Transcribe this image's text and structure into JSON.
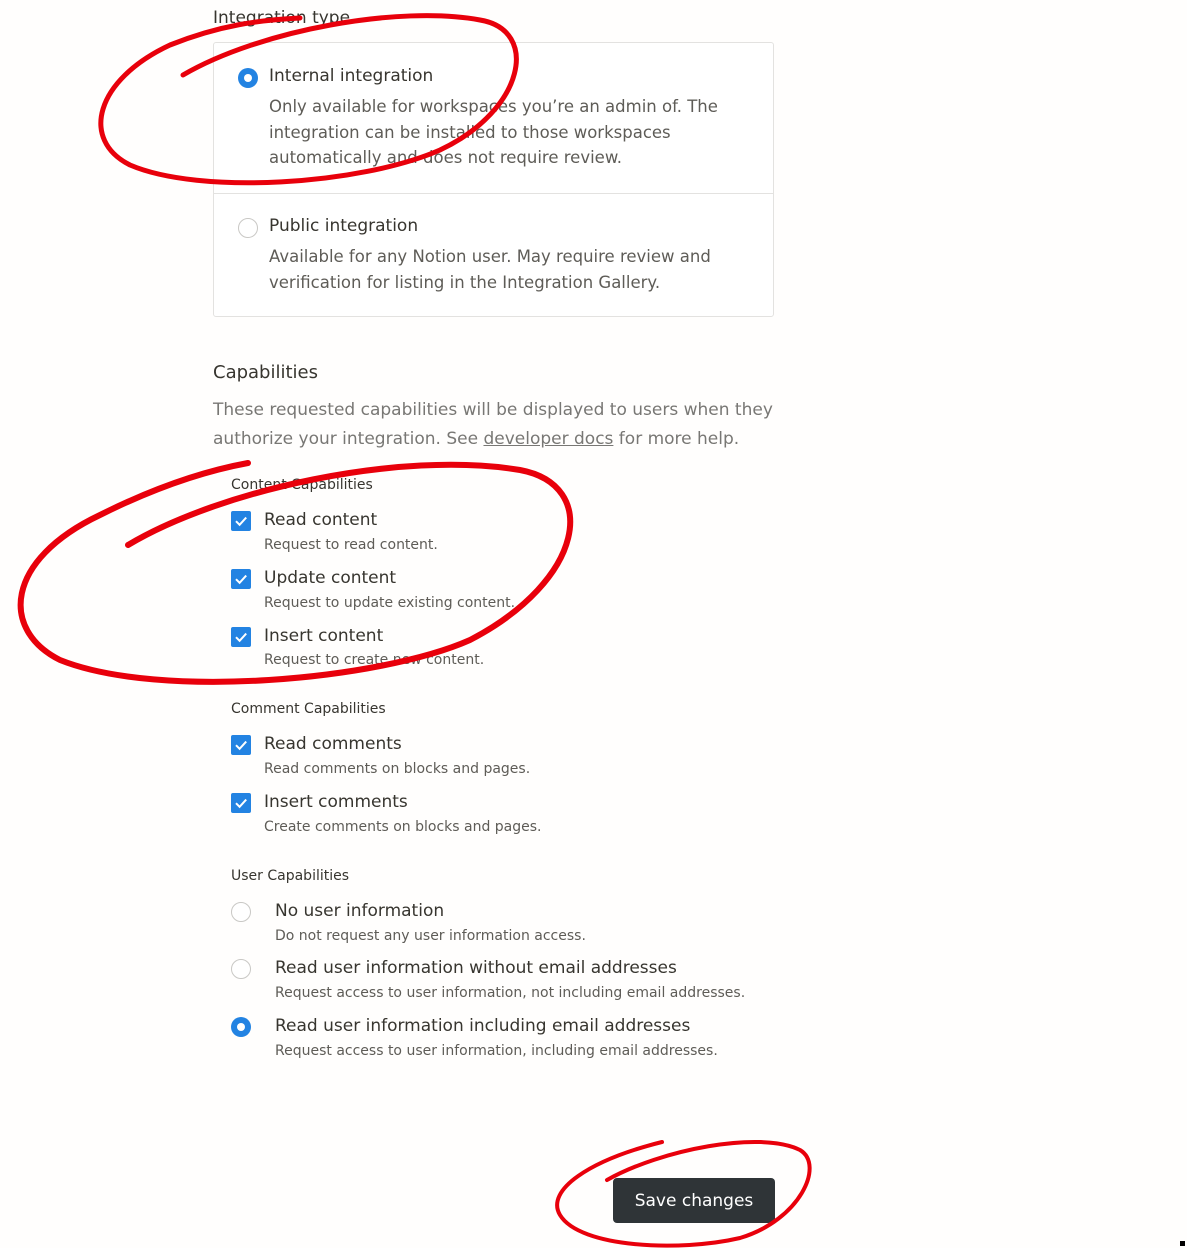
{
  "integration_type": {
    "label": "Integration type",
    "options": [
      {
        "title": "Internal integration",
        "description": "Only available for workspaces you’re an admin of. The integration can be installed to those workspaces automatically and does not require review.",
        "selected": true
      },
      {
        "title": "Public integration",
        "description": "Available for any Notion user. May require review and verification for listing in the Integration Gallery.",
        "selected": false
      }
    ]
  },
  "capabilities": {
    "title": "Capabilities",
    "description_before": "These requested capabilities will be displayed to users when they authorize your integration. See ",
    "link_text": "developer docs",
    "description_after": " for more help."
  },
  "content_capabilities": {
    "label": "Content Capabilities",
    "items": [
      {
        "title": "Read content",
        "description": "Request to read content.",
        "checked": true
      },
      {
        "title": "Update content",
        "description": "Request to update existing content.",
        "checked": true
      },
      {
        "title": "Insert content",
        "description": "Request to create new content.",
        "checked": true
      }
    ]
  },
  "comment_capabilities": {
    "label": "Comment Capabilities",
    "items": [
      {
        "title": "Read comments",
        "description": "Read comments on blocks and pages.",
        "checked": true
      },
      {
        "title": "Insert comments",
        "description": "Create comments on blocks and pages.",
        "checked": true
      }
    ]
  },
  "user_capabilities": {
    "label": "User Capabilities",
    "options": [
      {
        "title": "No user information",
        "description": "Do not request any user information access.",
        "selected": false
      },
      {
        "title": "Read user information without email addresses",
        "description": "Request access to user information, not including email addresses.",
        "selected": false
      },
      {
        "title": "Read user information including email addresses",
        "description": "Request access to user information, including email addresses.",
        "selected": true
      }
    ]
  },
  "save_button": {
    "label": "Save changes"
  },
  "colors": {
    "accent": "#2383e2",
    "button_bg": "#2f3437",
    "annotation": "#e8000b"
  }
}
